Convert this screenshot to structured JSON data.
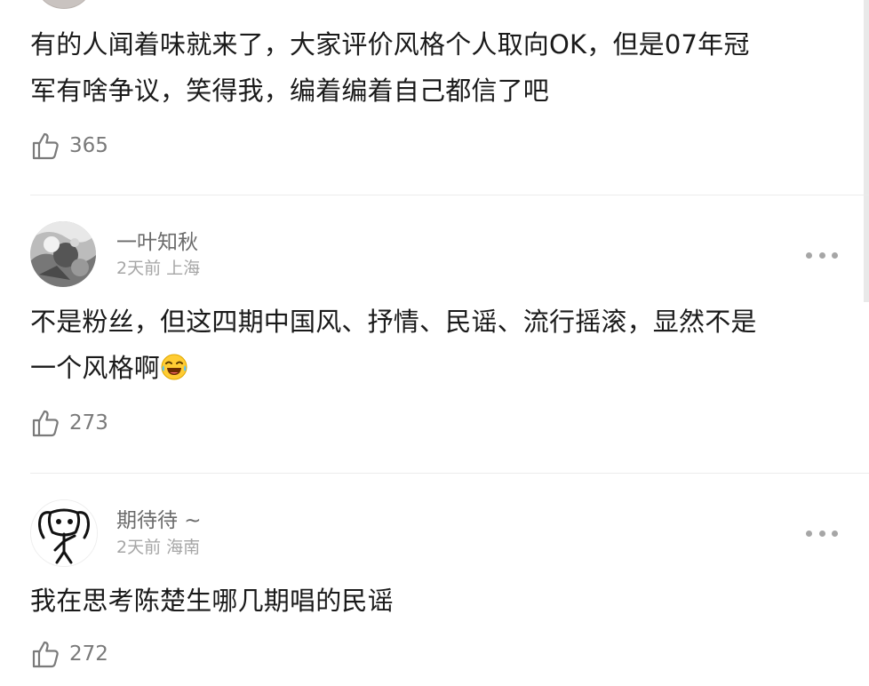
{
  "comments": [
    {
      "author": "",
      "meta": "",
      "text_line1": "有的人闻着味就来了，大家评价风格个人取向OK，但是07年冠",
      "text_line2": "军有啥争议，笑得我，编着编着自己都信了吧",
      "likes": "365"
    },
    {
      "author": "一叶知秋",
      "meta": "2天前 上海",
      "text_line1": "不是粉丝，但这四期中国风、抒情、民谣、流行摇滚，显然不是",
      "text_line2": "一个风格啊",
      "likes": "273"
    },
    {
      "author": "期待待 ~",
      "meta": "2天前 海南",
      "text_line1": "我在思考陈楚生哪几期唱的民谣",
      "likes": "272"
    }
  ],
  "icons": {
    "like": "thumbs-up-icon",
    "more": "more-dots-icon",
    "emoji": "laughing-tears-emoji-icon"
  },
  "colors": {
    "text": "#1a1a1a",
    "secondary": "#6b6b6b",
    "muted": "#a6a6a6",
    "divider": "#ececec"
  }
}
